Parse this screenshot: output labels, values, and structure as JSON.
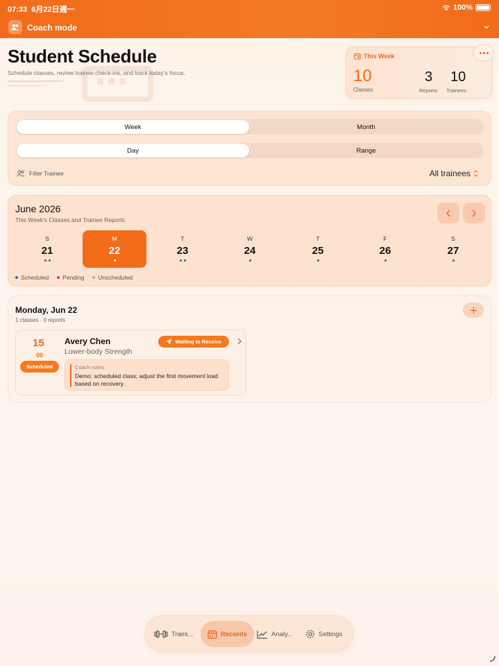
{
  "status": {
    "time": "07:33",
    "date": "6月22日週一",
    "battery": "100%"
  },
  "header": {
    "mode_label": "Coach mode"
  },
  "page": {
    "title": "Student Schedule",
    "subtitle": "Schedule classes, review trainee check-ins, and track today's focus."
  },
  "summary": {
    "heading": "This Week",
    "classes_value": "10",
    "classes_label": "Classes",
    "reports_value": "3",
    "reports_label": "Reports",
    "trainees_value": "10",
    "trainees_label": "Trainees"
  },
  "filters": {
    "range_options": [
      "Week",
      "Month"
    ],
    "range_selected": "Week",
    "mode_options": [
      "Day",
      "Range"
    ],
    "mode_selected": "Day",
    "filter_label": "Filter Trainee",
    "filter_value": "All trainees"
  },
  "calendar": {
    "month": "June 2026",
    "subtitle": "This Week's Classes and Trainee Reports",
    "days": [
      {
        "dow": "S",
        "num": "21",
        "dots": 2,
        "selected": false
      },
      {
        "dow": "M",
        "num": "22",
        "dots": 1,
        "selected": true
      },
      {
        "dow": "T",
        "num": "23",
        "dots": 2,
        "selected": false
      },
      {
        "dow": "W",
        "num": "24",
        "dots": 1,
        "selected": false
      },
      {
        "dow": "T",
        "num": "25",
        "dots": 1,
        "selected": false
      },
      {
        "dow": "F",
        "num": "26",
        "dots": 1,
        "selected": false
      },
      {
        "dow": "S",
        "num": "27",
        "dots": 1,
        "selected": false
      }
    ],
    "legend": [
      {
        "label": "Scheduled",
        "color": "#1b6e9a"
      },
      {
        "label": "Pending",
        "color": "#d6336c"
      },
      {
        "label": "Unscheduled",
        "color": "#aaaaaa"
      }
    ]
  },
  "day_detail": {
    "title": "Monday, Jun 22",
    "subtitle": "1 classes · 0 reports",
    "class": {
      "hour": "15",
      "minute": "00",
      "status": "Scheduled",
      "trainee": "Avery Chen",
      "program": "Lower-body Strength",
      "action": "Waiting to Receive",
      "notes_label": "Coach notes",
      "notes": "Demo: scheduled class; adjust the first movement load based on recovery."
    }
  },
  "tabbar": {
    "tabs": [
      "Traini...",
      "Records",
      "Analy...",
      "Settings"
    ],
    "active": "Records"
  },
  "colors": {
    "accent": "#f26c1a",
    "scheduled": "#1b6e9a",
    "pending": "#d6336c"
  }
}
